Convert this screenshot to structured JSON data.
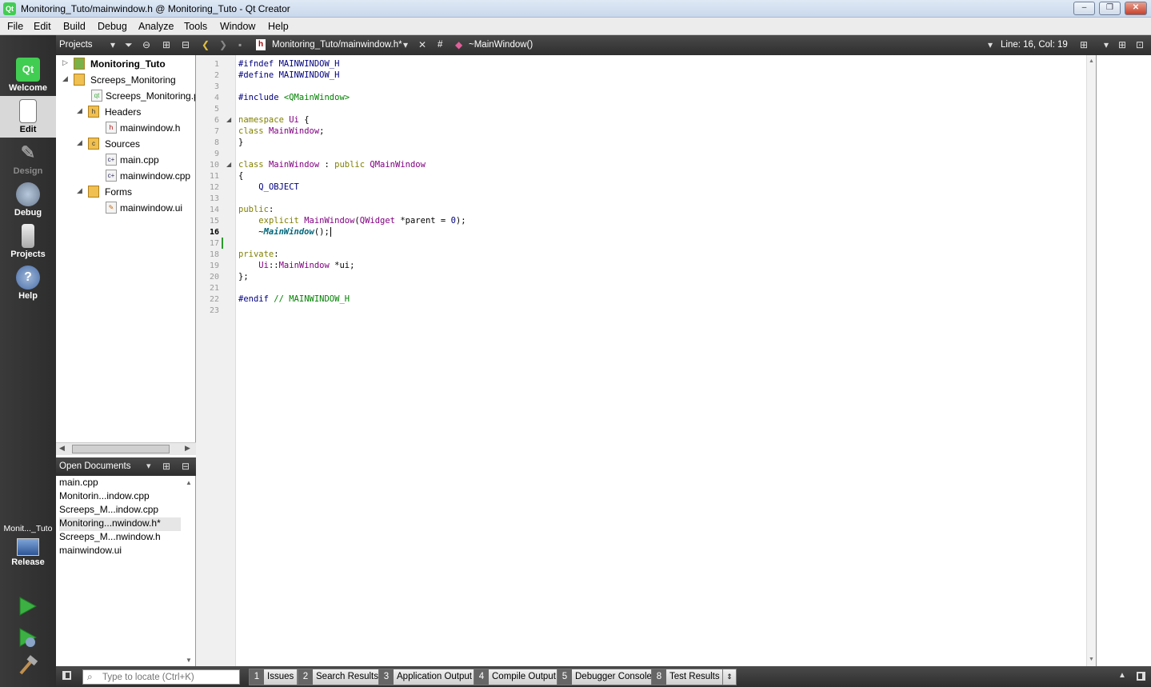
{
  "window": {
    "title": "Monitoring_Tuto/mainwindow.h @ Monitoring_Tuto - Qt Creator",
    "minimize": "–",
    "restore": "❐",
    "close": "✕"
  },
  "menu": [
    "File",
    "Edit",
    "Build",
    "Debug",
    "Analyze",
    "Tools",
    "Window",
    "Help"
  ],
  "modes": [
    {
      "label": "Welcome",
      "icon": "qt-logo-icon"
    },
    {
      "label": "Edit",
      "icon": "document-icon"
    },
    {
      "label": "Design",
      "icon": "design-pen-icon"
    },
    {
      "label": "Debug",
      "icon": "bug-icon"
    },
    {
      "label": "Projects",
      "icon": "wrench-icon"
    },
    {
      "label": "Help",
      "icon": "help-icon"
    }
  ],
  "kit": {
    "project": "Monit..._Tuto",
    "config": "Release"
  },
  "toolbar": {
    "panel_title": "Projects",
    "file_combo": "Monitoring_Tuto/mainwindow.h*",
    "hash": "#",
    "symbol": "~MainWindow()",
    "position": "Line: 16, Col: 19"
  },
  "tree": [
    {
      "label": "Monitoring_Tuto",
      "bold": true
    },
    {
      "label": "Screeps_Monitoring"
    },
    {
      "label": "Screeps_Monitoring.p"
    },
    {
      "label": "Headers"
    },
    {
      "label": "mainwindow.h"
    },
    {
      "label": "Sources"
    },
    {
      "label": "main.cpp"
    },
    {
      "label": "mainwindow.cpp"
    },
    {
      "label": "Forms"
    },
    {
      "label": "mainwindow.ui"
    }
  ],
  "open_docs": {
    "title": "Open Documents",
    "items": [
      "main.cpp",
      "Monitorin...indow.cpp",
      "Screeps_M...indow.cpp",
      "Monitoring...nwindow.h*",
      "Screeps_M...nwindow.h",
      "mainwindow.ui"
    ]
  },
  "editor": {
    "current_line": "16",
    "line_numbers": [
      "1",
      "2",
      "3",
      "4",
      "5",
      "6",
      "7",
      "8",
      "9",
      "10",
      "11",
      "12",
      "13",
      "14",
      "15",
      "16",
      "17",
      "18",
      "19",
      "20",
      "21",
      "22",
      "23"
    ]
  },
  "statusbar": {
    "locate_placeholder": "Type to locate (Ctrl+K)",
    "panes": [
      {
        "num": "1",
        "label": "Issues"
      },
      {
        "num": "2",
        "label": "Search Results"
      },
      {
        "num": "3",
        "label": "Application Output"
      },
      {
        "num": "4",
        "label": "Compile Output"
      },
      {
        "num": "5",
        "label": "Debugger Console"
      },
      {
        "num": "8",
        "label": "Test Results"
      }
    ]
  },
  "colors": {
    "keyword": "#808000",
    "preprocessor": "#000080",
    "type": "#800080",
    "comment": "#008000",
    "accent_run": "#3cb043"
  }
}
